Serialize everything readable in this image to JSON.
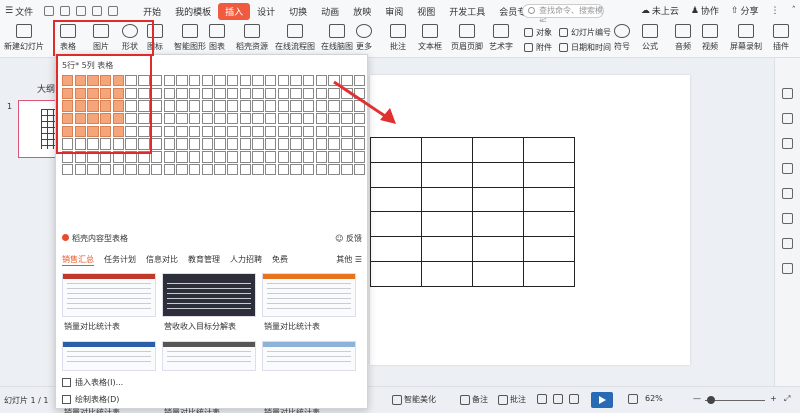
{
  "menubar": {
    "file_label": "文件",
    "tabs": [
      "开始",
      "我的模板",
      "插入",
      "设计",
      "切换",
      "动画",
      "放映",
      "审阅",
      "视图",
      "开发工具",
      "会员专享"
    ],
    "active_tab": "插入",
    "search_placeholder": "查找命令、搜索模板",
    "cloud_label": "未上云",
    "collab_label": "协作",
    "share_label": "分享"
  },
  "ribbon": {
    "new_slide": "新建幻灯片",
    "table": "表格",
    "picture": "图片",
    "shape": "形状",
    "icon": "图标",
    "smart_graphic": "智能图形",
    "chart": "图表",
    "resources": "稻壳资源",
    "flowchart": "在线流程图",
    "mindmap": "在线脑图",
    "more": "更多",
    "comment": "批注",
    "textbox": "文本框",
    "header_footer": "页眉页脚",
    "art_text": "艺术字",
    "object": "对象",
    "attachment": "附件",
    "slide_number": "幻灯片编号",
    "datetime": "日期和时间",
    "symbol": "符号",
    "formula": "公式",
    "audio": "音频",
    "video": "视频",
    "screen_record": "屏幕录制",
    "ribbon_end": "插件"
  },
  "leftpanel": {
    "outline_tab": "大纲",
    "slide_number": "1"
  },
  "dropdown": {
    "grid_title": "5行* 5列 表格",
    "selected_rows": 5,
    "selected_cols": 5,
    "grid_rows": 8,
    "grid_cols": 24,
    "template_header": "稻壳内容型表格",
    "feedback": "反馈",
    "categories": [
      "销售汇总",
      "任务计划",
      "信息对比",
      "教育管理",
      "人力招聘",
      "免费"
    ],
    "active_category": "销售汇总",
    "more_label": "其他",
    "templates": [
      {
        "caption": "销量对比统计表",
        "accent": "#c0392b",
        "dark": false
      },
      {
        "caption": "营收收入目标分解表",
        "accent": "#2c2f3a",
        "dark": true
      },
      {
        "caption": "销量对比统计表",
        "accent": "#e8731f",
        "dark": false
      },
      {
        "caption": "销量对比统计表",
        "accent": "#2b5ea8",
        "dark": false
      },
      {
        "caption": "销量对比统计表",
        "accent": "#555555",
        "dark": false
      },
      {
        "caption": "销量对比统计表",
        "accent": "#8fb2d9",
        "dark": false
      }
    ],
    "insert_table": "插入表格(I)...",
    "draw_table": "绘制表格(D)"
  },
  "statusbar": {
    "slide_info": "幻灯片 1 / 1",
    "smart_beautify": "智能美化",
    "notes": "备注",
    "annotate": "批注",
    "zoom": "62%"
  },
  "slide_table": {
    "rows": 6,
    "cols": 4
  },
  "colors": {
    "accent": "#f05a3e",
    "selected_cell": "#f4a579",
    "highlight_box": "#e32a2a",
    "arrow": "#e03030"
  }
}
